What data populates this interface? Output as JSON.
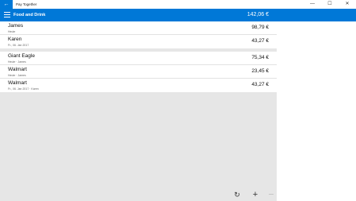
{
  "window": {
    "back_glyph": "←",
    "app_title": "Pay Together",
    "minimize_glyph": "—",
    "maximize_glyph": "☐",
    "close_glyph": "✕"
  },
  "header": {
    "title": "Food and Drink",
    "total": "142,06 €"
  },
  "groups": [
    {
      "rows": [
        {
          "name": "James",
          "sub": "Heute",
          "amount": "98,79 €"
        },
        {
          "name": "Karen",
          "sub": "Fr., 06. Jan 2017",
          "amount": "43,27 €"
        }
      ]
    },
    {
      "rows": [
        {
          "name": "Giant Eagle",
          "sub": "Heute · James",
          "amount": "75,34 €"
        },
        {
          "name": "Walmart",
          "sub": "Heute · James",
          "amount": "23,45 €"
        },
        {
          "name": "Walmart",
          "sub": "Fr., 06. Jan 2017 · Karen",
          "amount": "43,27 €"
        }
      ]
    }
  ],
  "commands": {
    "refresh_glyph": "↻",
    "add_glyph": "+",
    "more_glyph": "···"
  },
  "colors": {
    "accent": "#0078d7"
  }
}
